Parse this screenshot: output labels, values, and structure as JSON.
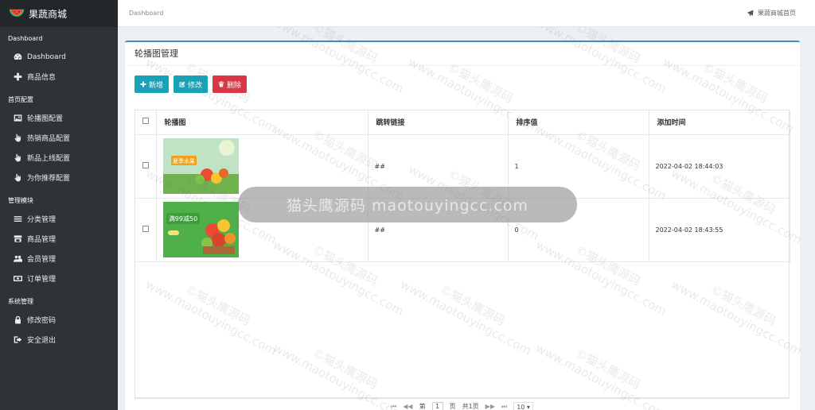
{
  "app": {
    "title": "果蔬商城"
  },
  "sidebar": {
    "sections": [
      {
        "title": "Dashboard",
        "items": [
          {
            "label": "Dashboard",
            "icon": "dashboard-icon"
          },
          {
            "label": "商品信息",
            "icon": "plus-icon"
          }
        ]
      },
      {
        "title": "首页配置",
        "items": [
          {
            "label": "轮播图配置",
            "icon": "image-icon"
          },
          {
            "label": "热销商品配置",
            "icon": "hand-pointer-icon"
          },
          {
            "label": "新品上线配置",
            "icon": "hand-pointer-icon"
          },
          {
            "label": "为你推荐配置",
            "icon": "hand-pointer-icon"
          }
        ]
      },
      {
        "title": "管理模块",
        "items": [
          {
            "label": "分类管理",
            "icon": "list-icon"
          },
          {
            "label": "商品管理",
            "icon": "store-icon"
          },
          {
            "label": "会员管理",
            "icon": "users-icon"
          },
          {
            "label": "订单管理",
            "icon": "money-icon"
          }
        ]
      },
      {
        "title": "系统管理",
        "items": [
          {
            "label": "修改密码",
            "icon": "lock-icon"
          },
          {
            "label": "安全退出",
            "icon": "sign-out-icon"
          }
        ]
      }
    ]
  },
  "topbar": {
    "breadcrumb": "Dashboard",
    "home_link": "果蔬商城首页"
  },
  "panel": {
    "title": "轮播图管理"
  },
  "toolbar": {
    "add_label": "新增",
    "edit_label": "修改",
    "delete_label": "删除"
  },
  "table": {
    "columns": [
      "轮播图",
      "跳转链接",
      "排序值",
      "添加时间"
    ],
    "rows": [
      {
        "image_text": "夏季水果",
        "link": "##",
        "order": "1",
        "added": "2022-04-02 18:44:03"
      },
      {
        "image_text": "满99减50",
        "link": "##",
        "order": "0",
        "added": "2022-04-02 18:43:55"
      }
    ]
  },
  "pager": {
    "first": "⏮",
    "prev": "◀◀",
    "page_prefix": "第",
    "page_value": "1",
    "page_suffix": "页",
    "total": "共1页",
    "next": "▶▶",
    "last": "⏭",
    "size": "10"
  },
  "watermark": {
    "line1": "©猫头鹰源码",
    "line2": "www.maotouyingcc.com",
    "center": "猫头鹰源码 maotouyingcc.com"
  },
  "colors": {
    "sidebar_bg": "#2f3337",
    "accent": "#17a2b8",
    "danger": "#dc3545",
    "panel_top": "#3c8dbc"
  }
}
